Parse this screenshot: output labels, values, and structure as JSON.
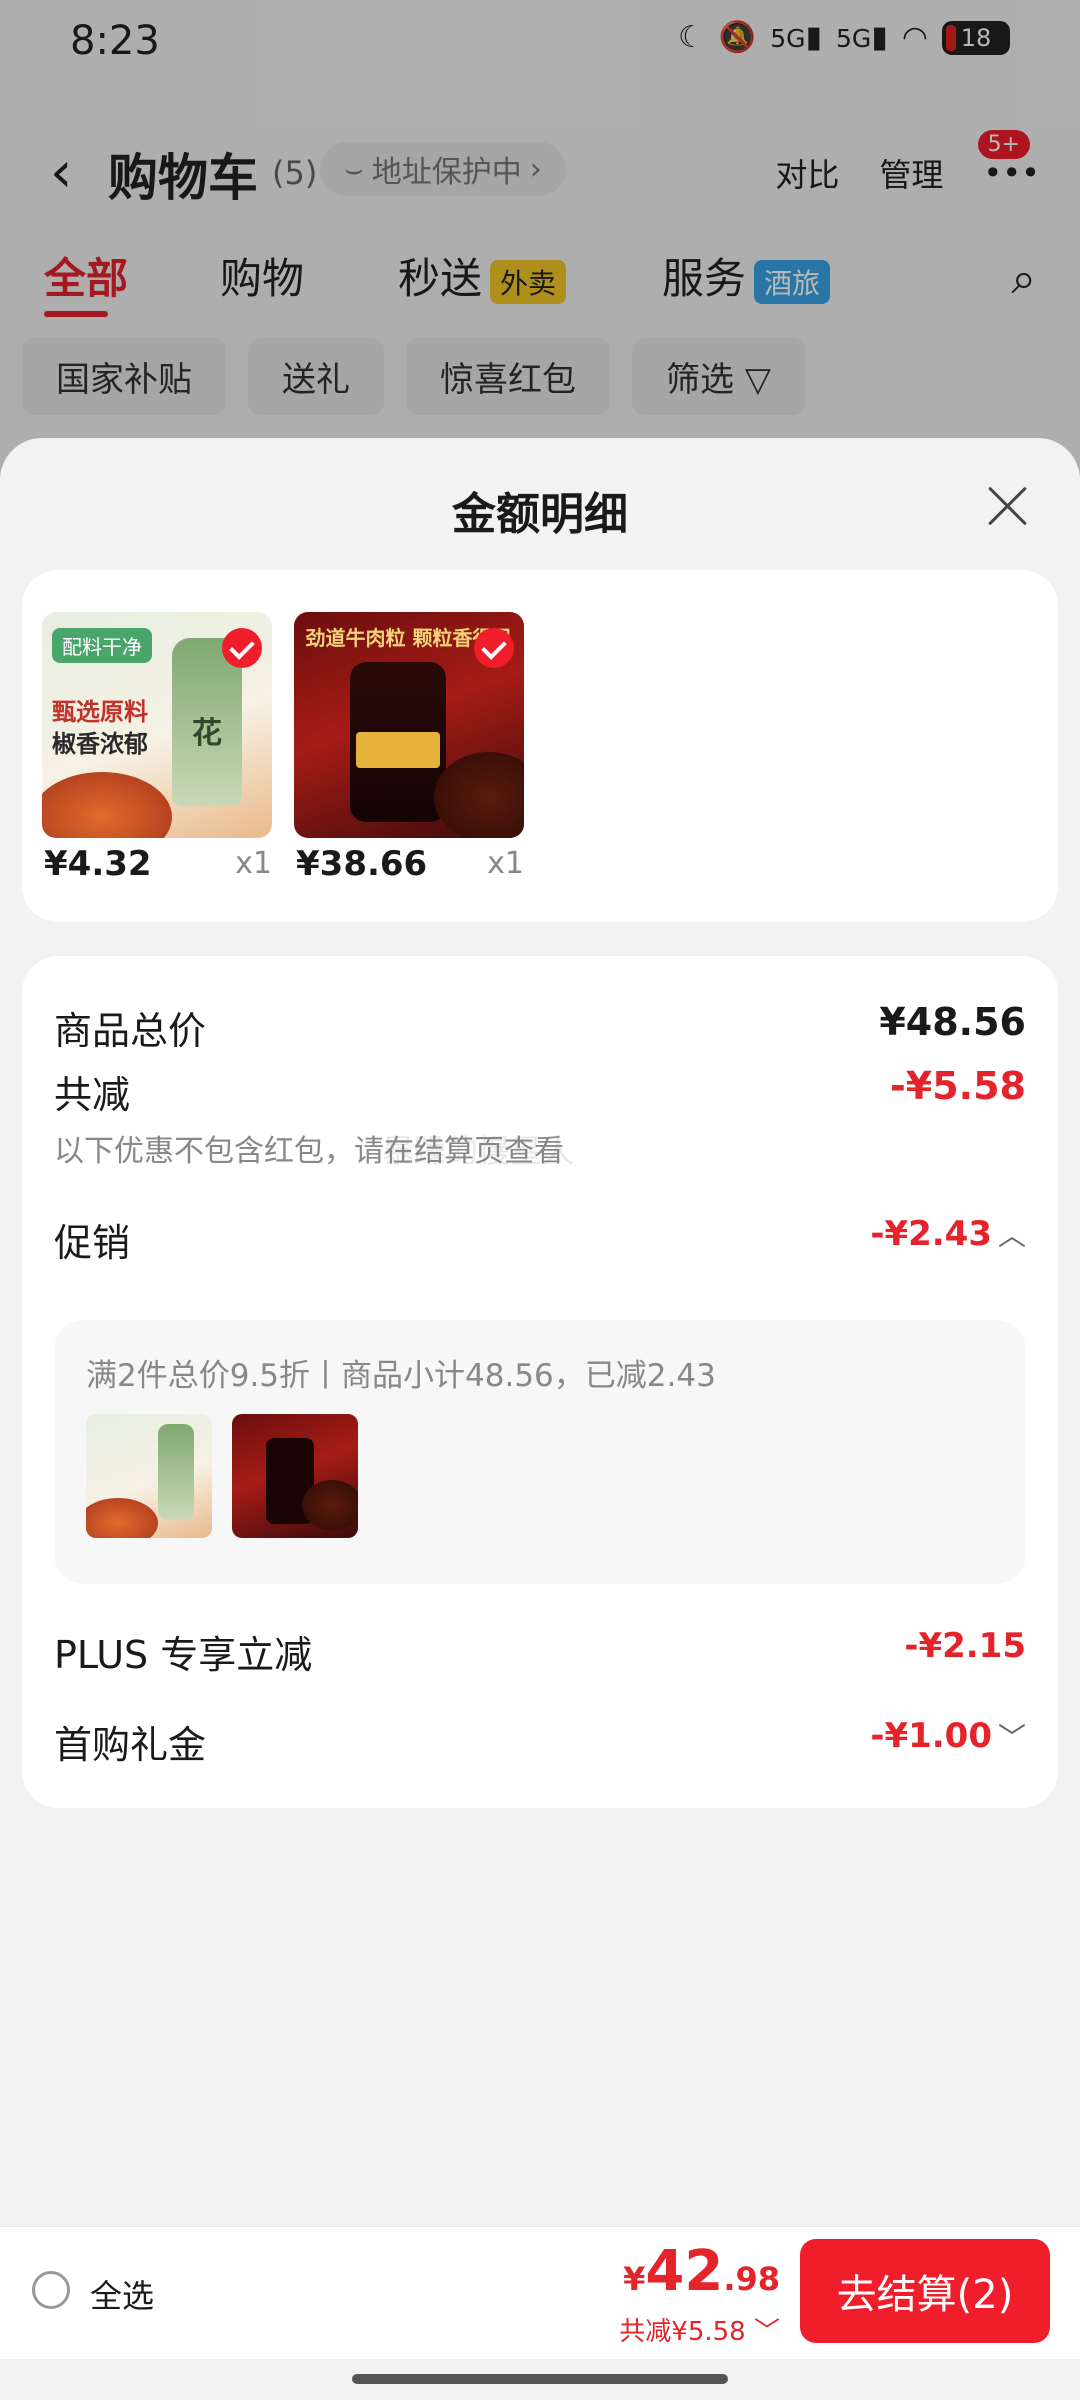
{
  "status_bar": {
    "time": "8:23",
    "network": "5G",
    "network2": "5G",
    "battery": "18"
  },
  "header": {
    "title": "购物车",
    "count": "(5)",
    "address_chip": "地址保护中",
    "compare": "对比",
    "manage": "管理",
    "more_badge": "5+"
  },
  "tabs": [
    {
      "label": "全部"
    },
    {
      "label": "购物"
    },
    {
      "label": "秒送",
      "tag": "外卖"
    },
    {
      "label": "服务",
      "tag": "酒旅"
    }
  ],
  "chips": [
    "国家补贴",
    "送礼",
    "惊喜红包",
    "筛选"
  ],
  "sheet": {
    "title": "金额明细",
    "products": [
      {
        "price": "¥4.32",
        "qty": "x1",
        "image": {
          "badge": "配料干净",
          "line1": "甄选原料",
          "line2": "椒香浓郁",
          "jar_text": "花"
        }
      },
      {
        "price": "¥38.66",
        "qty": "x1",
        "image": {
          "banner": "劲道牛肉粒 颗粒香得见"
        }
      }
    ],
    "details": {
      "subtotal_label": "商品总价",
      "subtotal_value": "¥48.56",
      "discount_label": "共减",
      "discount_value": "-¥5.58",
      "discount_note": "以下优惠不包含红包，请在结算页查看",
      "watermark": "暴躁的慢星人",
      "promo_label": "促销",
      "promo_value": "-¥2.43",
      "promo_detail": "满2件总价9.5折丨商品小计48.56，已减2.43",
      "plus_label": "PLUS 专享立减",
      "plus_value": "-¥2.15",
      "first_label": "首购礼金",
      "first_value": "-¥1.00"
    }
  },
  "bottom_bar": {
    "select_all": "全选",
    "total_symbol": "¥",
    "total_int": "42",
    "total_dec": ".98",
    "saved": "共减¥5.58",
    "checkout": "去结算(2)"
  },
  "colors": {
    "accent": "#e4232b",
    "checkout_bg": "#f01d2b"
  }
}
